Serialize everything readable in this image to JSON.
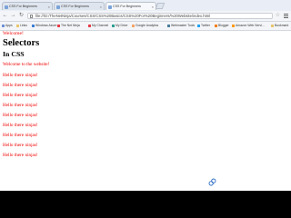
{
  "browser": {
    "tabs": [
      {
        "label": "CSS For Beginners",
        "active": false
      },
      {
        "label": "CSS For Beginners",
        "active": false
      },
      {
        "label": "CSS For Beginners",
        "active": true
      }
    ],
    "address": "file:///D:/TheNetNinja/Courses/CSS/CSS%20Basics/CSS%20For%20Beginners/%20Website/index.html",
    "bookmarks": [
      {
        "label": "Apps",
        "color": "#6b8fd6"
      },
      {
        "label": "Links",
        "color": "#e9c46a"
      },
      {
        "label": "Windows Azure",
        "color": "#3a7bd5"
      },
      {
        "label": "The Net Ninja",
        "color": "#e63946"
      },
      {
        "label": "My Channel",
        "color": "#e63946"
      },
      {
        "label": "My Drive",
        "color": "#2a9d8f"
      },
      {
        "label": "Google Analytics",
        "color": "#f4a261"
      },
      {
        "label": "Webmaster Tools",
        "color": "#457b9d"
      },
      {
        "label": "Twitter",
        "color": "#1da1f2"
      },
      {
        "label": "Blogger",
        "color": "#f57d00"
      },
      {
        "label": "Amazon Web Servi...",
        "color": "#ff9900"
      },
      {
        "label": "Bookmark",
        "color": "#e9c46a"
      }
    ]
  },
  "page": {
    "welcome": "Welcome!",
    "heading": "Selectors",
    "subheading": "In CSS",
    "welcome_line": "Welcome to the website!",
    "lines": [
      "Hello there ninjas!",
      "Hello there ninjas!",
      "Hello there ninjas!",
      "Hello there ninjas!",
      "Hello there ninjas!",
      "Hello there ninjas!",
      "Hello there ninjas!",
      "Hello there ninjas!",
      "Hello there ninjas!"
    ]
  },
  "colors": {
    "text_red": "#ee0000",
    "text_black": "#000000",
    "tab_strip": "#e9eef6"
  }
}
